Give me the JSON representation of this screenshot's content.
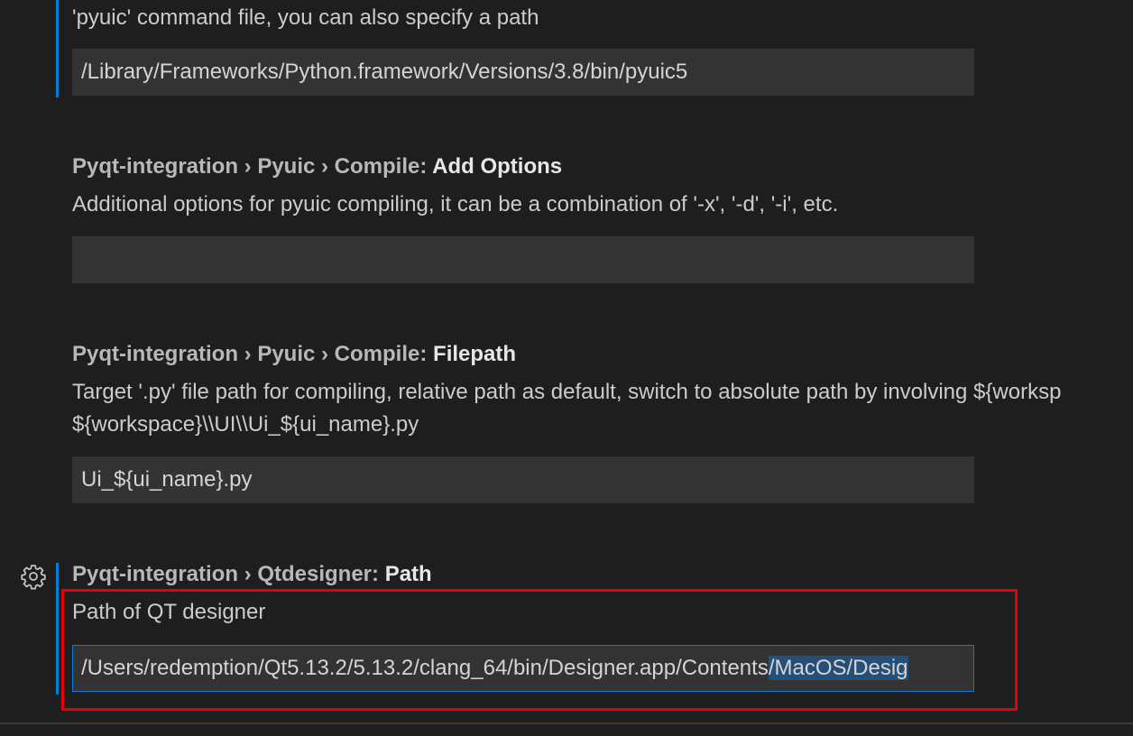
{
  "settings": [
    {
      "description": "'pyuic' command file, you can also specify a path",
      "value": "/Library/Frameworks/Python.framework/Versions/3.8/bin/pyuic5"
    },
    {
      "category": "Pyqt-integration › Pyuic › Compile: ",
      "name": "Add Options",
      "description": "Additional options for pyuic compiling, it can be a combination of '-x', '-d', '-i', etc.",
      "value": ""
    },
    {
      "category": "Pyqt-integration › Pyuic › Compile: ",
      "name": "Filepath",
      "description_line1": "Target '.py' file path for compiling, relative path as default, switch to absolute path by involving ${worksp",
      "description_line2": "${workspace}\\\\UI\\\\Ui_${ui_name}.py",
      "value": "Ui_${ui_name}.py"
    },
    {
      "category": "Pyqt-integration › Qtdesigner: ",
      "name": "Path",
      "description": "Path of QT designer",
      "value_unselected": "/Users/redemption/Qt5.13.2/5.13.2/clang_64/bin/Designer.app/Contents",
      "value_selected": "/MacOS/Desig"
    }
  ],
  "icons": {
    "gear": "gear-icon"
  },
  "colors": {
    "background": "#1e1e1e",
    "input_background": "#333333",
    "focus_border": "#007fd4",
    "selection": "#264f78",
    "annotation_box": "#e3000b"
  }
}
